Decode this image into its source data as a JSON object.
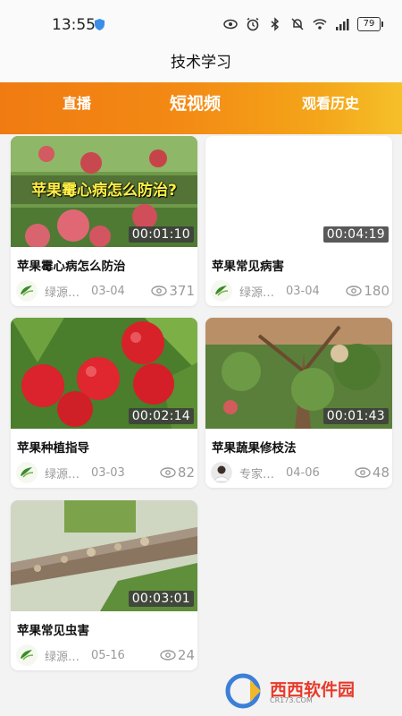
{
  "status": {
    "time": "13:55",
    "battery": "79",
    "icons": [
      "eye-icon",
      "alarm-icon",
      "bluetooth-icon",
      "mute-icon",
      "wifi-icon",
      "signal-icon",
      "battery-icon"
    ]
  },
  "header": {
    "title": "技术学习"
  },
  "tabs": {
    "live": "直播",
    "short_video": "短视频",
    "history": "观看历史",
    "active": "short_video"
  },
  "colors": {
    "accent_start": "#f07b12",
    "accent_end": "#f6c02a",
    "brand_green": "#3a8a2a"
  },
  "videos": [
    {
      "title": "苹果霉心病怎么防治",
      "overlay": "苹果霉心病怎么防治?",
      "duration": "00:01:10",
      "author": "绿源…",
      "date": "03-04",
      "views": "371",
      "avatar": "brand-logo"
    },
    {
      "title": "苹果常见病害",
      "duration": "00:04:19",
      "author": "绿源…",
      "date": "03-04",
      "views": "180",
      "avatar": "brand-logo"
    },
    {
      "title": "苹果种植指导",
      "duration": "00:02:14",
      "author": "绿源…",
      "date": "03-03",
      "views": "82",
      "avatar": "brand-logo"
    },
    {
      "title": "苹果蔬果修枝法",
      "duration": "00:01:43",
      "author": "专家…",
      "date": "04-06",
      "views": "48",
      "avatar": "expert-photo"
    },
    {
      "title": "苹果常见虫害",
      "duration": "00:03:01",
      "author": "绿源…",
      "date": "05-16",
      "views": "24",
      "avatar": "brand-logo"
    }
  ],
  "watermark": {
    "text": "西西软件园",
    "sub": "CR173.COM"
  }
}
